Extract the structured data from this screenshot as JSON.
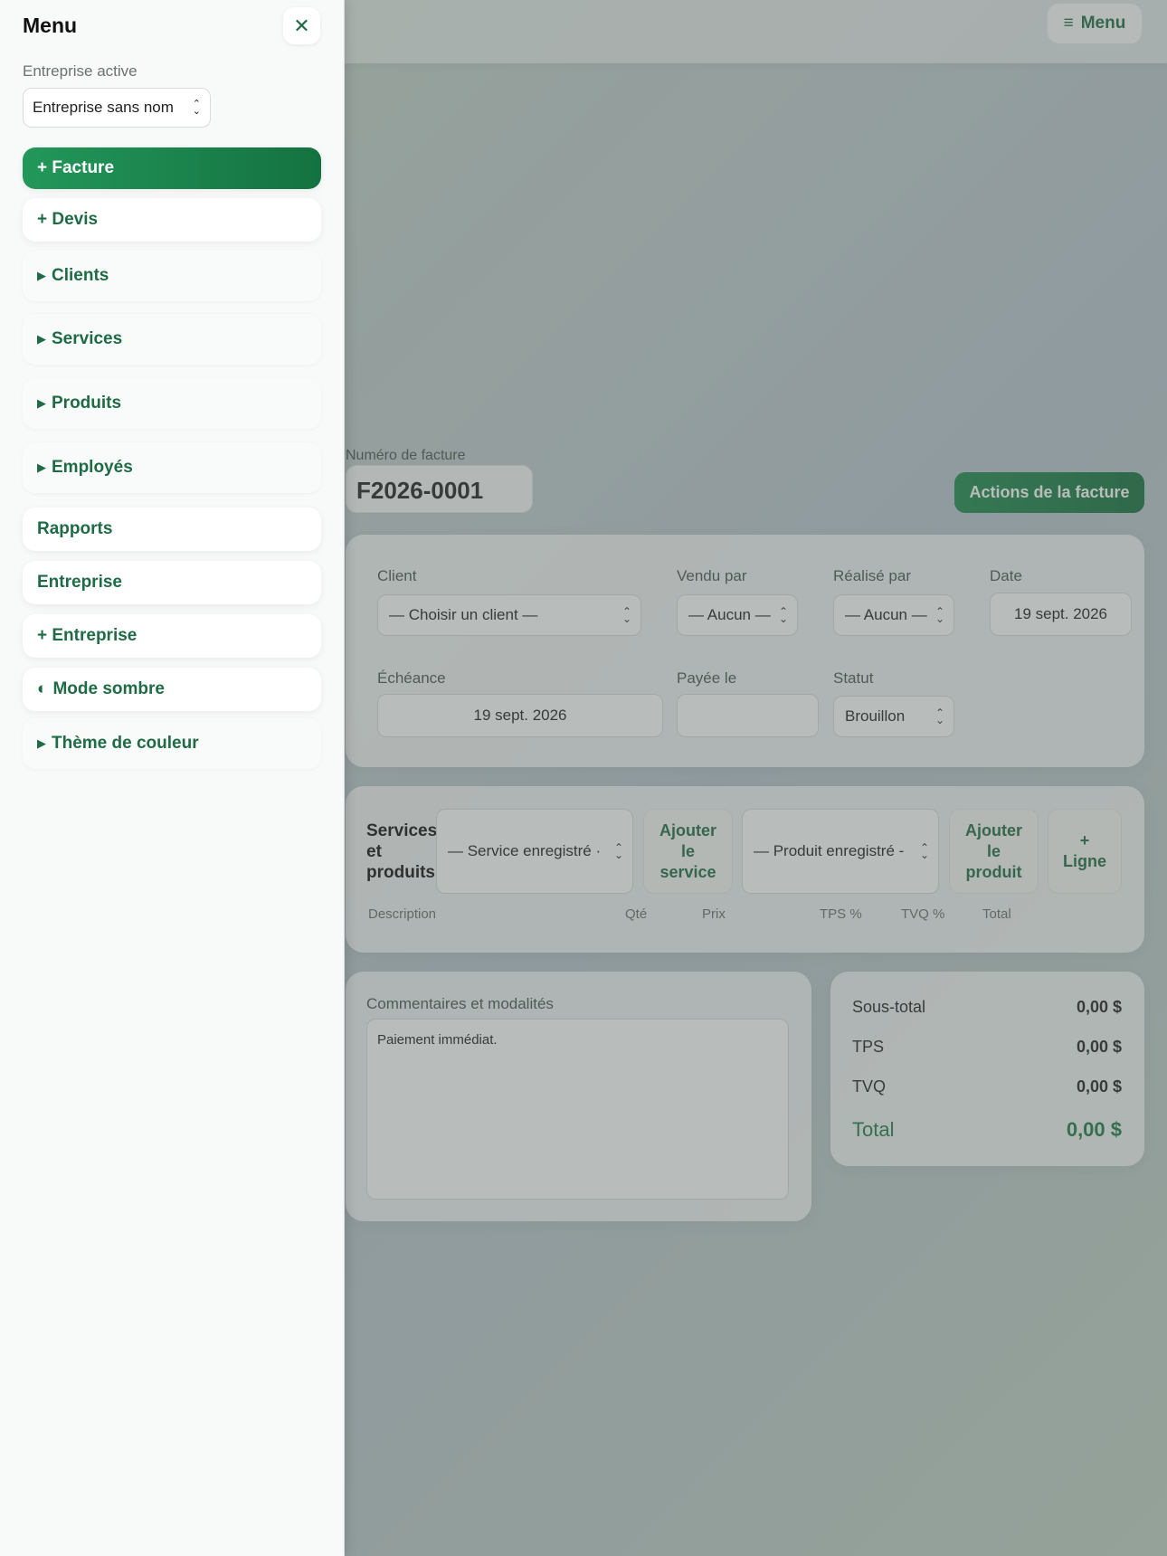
{
  "topbar": {
    "menu_label": "Menu",
    "menu_icon": "hamburger-icon"
  },
  "invoice": {
    "number_label": "Numéro de facture",
    "number": "F2026-0001",
    "actions_label": "Actions de la facture",
    "client_label": "Client",
    "client_value": "— Choisir un client —",
    "sold_by_label": "Vendu par",
    "sold_by_value": "— Aucun —",
    "done_by_label": "Réalisé par",
    "done_by_value": "— Aucun —",
    "date_label": "Date",
    "date_value": "19 sept. 2026",
    "due_label": "Échéance",
    "due_value": "19 sept. 2026",
    "paid_label": "Payée le",
    "paid_value": "",
    "status_label": "Statut",
    "status_value": "Brouillon"
  },
  "lines": {
    "title": "Services et produits",
    "service_select": "— Service enregistré ·",
    "add_service": "Ajouter le service",
    "product_select": "— Produit enregistré -",
    "add_product": "Ajouter le produit",
    "add_line": "+ Ligne",
    "columns": [
      "Description",
      "Qté",
      "Prix",
      "TPS %",
      "TVQ %",
      "Total"
    ]
  },
  "notes": {
    "label": "Commentaires et modalités",
    "value": "Paiement immédiat."
  },
  "totals": {
    "subtotal_label": "Sous-total",
    "subtotal": "0,00 $",
    "tps_label": "TPS",
    "tps": "0,00 $",
    "tvq_label": "TVQ",
    "tvq": "0,00 $",
    "total_label": "Total",
    "total": "0,00 $"
  },
  "drawer": {
    "title": "Menu",
    "close_icon": "close-icon",
    "active_company_label": "Entreprise active",
    "active_company_value": "Entreprise sans nom",
    "items": [
      {
        "label": "+ Facture"
      },
      {
        "label": "+ Devis"
      },
      {
        "label": "Clients",
        "marker": "▶"
      },
      {
        "label": "Services",
        "marker": "▶"
      },
      {
        "label": "Produits",
        "marker": "▶"
      },
      {
        "label": "Employés",
        "marker": "▶"
      },
      {
        "label": "Rapports"
      },
      {
        "label": "Entreprise"
      },
      {
        "label": "+ Entreprise"
      },
      {
        "label": "Mode sombre",
        "marker": "◐"
      },
      {
        "label": "Thème de couleur",
        "marker": "▶"
      }
    ]
  },
  "colors": {
    "brand_green": "#1f6b45",
    "primary_button": "#1f8a4f"
  }
}
